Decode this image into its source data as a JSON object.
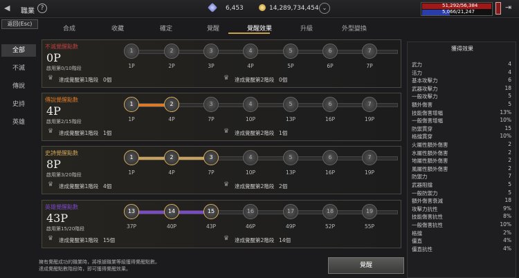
{
  "topbar": {
    "title": "職業",
    "help": "?",
    "gems": "6,453",
    "gold": "14,289,734,454",
    "hp": "51,292/56,384",
    "mp": "5,066/21,247"
  },
  "esc": "返回(Esc)",
  "tabs": [
    "合成",
    "收藏",
    "確定",
    "覺醒",
    "覺醒效果",
    "升級",
    "外型變換"
  ],
  "side": [
    "全部",
    "不滅",
    "傳說",
    "史詩",
    "英雄"
  ],
  "cards": [
    {
      "label": "不滅覺醒點數",
      "points": "0P",
      "sub": "啟用第0/10階段",
      "ach1": "達成覺醒第1階段",
      "c1": "0個",
      "ach2": "達成覺醒第2階段",
      "c2": "0個",
      "nodes": [
        "1",
        "2",
        "3",
        "4",
        "5",
        "6",
        "7"
      ],
      "labels": [
        "1P",
        "2P",
        "3P",
        "4P",
        "5P",
        "6P",
        "7P"
      ],
      "active": 0,
      "color": "#b84040"
    },
    {
      "label": "傳說覺醒點數",
      "points": "4P",
      "sub": "啟用第2/15階段",
      "ach1": "達成覺醒第1階段",
      "c1": "1個",
      "ach2": "達成覺醒第2階段",
      "c2": "1個",
      "nodes": [
        "1",
        "2",
        "3",
        "4",
        "5",
        "6",
        "7"
      ],
      "labels": [
        "1P",
        "4P",
        "7P",
        "10P",
        "13P",
        "16P",
        "19P"
      ],
      "active": 2,
      "color": "#d87a2a"
    },
    {
      "label": "史詩覺醒點數",
      "points": "8P",
      "sub": "啟用第3/20階段",
      "ach1": "達成覺醒第1階段",
      "c1": "4個",
      "ach2": "達成覺醒第2階段",
      "c2": "2個",
      "nodes": [
        "1",
        "2",
        "3",
        "4",
        "5",
        "6",
        "7"
      ],
      "labels": [
        "1P",
        "4P",
        "7P",
        "10P",
        "13P",
        "16P",
        "19P"
      ],
      "active": 3,
      "color": "#c9a05a"
    },
    {
      "label": "英雄覺醒點數",
      "points": "43P",
      "sub": "啟用第15/20階段",
      "ach1": "達成覺醒第1階段",
      "c1": "15個",
      "ach2": "達成覺醒第2階段",
      "c2": "14個",
      "nodes": [
        "13",
        "14",
        "15",
        "16",
        "17",
        "18",
        "19"
      ],
      "labels": [
        "37P",
        "40P",
        "43P",
        "46P",
        "49P",
        "52P",
        "55P"
      ],
      "active": 3,
      "color": "#7a4ac8"
    }
  ],
  "rpanel": {
    "title": "獲得效果",
    "rows": [
      [
        "武力",
        "4"
      ],
      [
        "活力",
        "4"
      ],
      [
        "基本攻擊力",
        "6"
      ],
      [
        "武器攻擊力",
        "18"
      ],
      [
        "一般攻擊力",
        "5"
      ],
      [
        "額外傷害",
        "5"
      ],
      [
        "技能傷害增幅",
        "13%"
      ],
      [
        "一般傷害增幅",
        "10%"
      ],
      [
        "防禦貫穿",
        "15"
      ],
      [
        "格擋貫穿",
        "10%"
      ],
      [
        "火屬性額外傷害",
        "2"
      ],
      [
        "水屬性額外傷害",
        "2"
      ],
      [
        "地屬性額外傷害",
        "2"
      ],
      [
        "風屬性額外傷害",
        "2"
      ],
      [
        "防禦力",
        "7"
      ],
      [
        "武器阻擋",
        "5"
      ],
      [
        "一般防禦力",
        "5"
      ],
      [
        "額外傷害衰減",
        "18"
      ],
      [
        "攻擊力抗性",
        "9%"
      ],
      [
        "技能傷害抗性",
        "8%"
      ],
      [
        "一般傷害抗性",
        "10%"
      ],
      [
        "格擋",
        "2%"
      ],
      [
        "僵直",
        "4%"
      ],
      [
        "僵直抗性",
        "4%"
      ]
    ]
  },
  "note1": "擁有覺醒成功的職業時，將根據職業等級獲得覺醒點數。",
  "note2": "達成覺醒點數階段時，即可獲得覺醒效果。",
  "awaken": "覺醒"
}
